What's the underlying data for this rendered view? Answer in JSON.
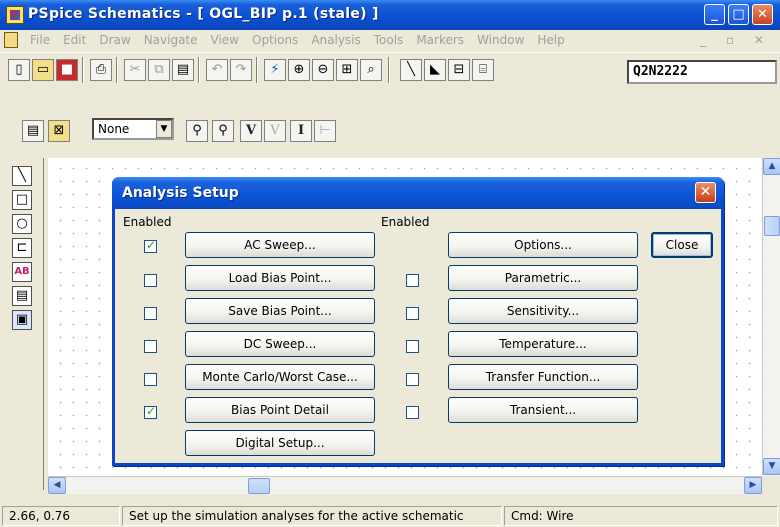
{
  "window": {
    "title": "PSpice Schematics - [ OGL_BIP  p.1  (stale) ]",
    "min_glyph": "_",
    "max_glyph": "□",
    "close_glyph": "✕"
  },
  "menu": {
    "items": [
      "File",
      "Edit",
      "Draw",
      "Navigate",
      "View",
      "Options",
      "Analysis",
      "Tools",
      "Markers",
      "Window",
      "Help"
    ],
    "mdi_controls": "_ ▫ ✕"
  },
  "toolbar": {
    "part_name": "Q2N2222",
    "display_combo": "None",
    "combo_arrow": "▼"
  },
  "status": {
    "coords": "2.66, 0.76",
    "message": "Set up the simulation analyses for the active schematic",
    "command": "Cmd: Wire"
  },
  "dialog": {
    "title": "Analysis Setup",
    "close_glyph": "✕",
    "left_header": "Enabled",
    "right_header": "Enabled",
    "close_button": "Close",
    "left": [
      {
        "label": "AC Sweep...",
        "checked": true
      },
      {
        "label": "Load Bias Point...",
        "checked": false
      },
      {
        "label": "Save Bias Point...",
        "checked": false
      },
      {
        "label": "DC Sweep...",
        "checked": false
      },
      {
        "label": "Monte Carlo/Worst Case...",
        "checked": false
      },
      {
        "label": "Bias Point Detail",
        "checked": true
      },
      {
        "label": "Digital Setup..."
      }
    ],
    "right": [
      {
        "label": "Options..."
      },
      {
        "label": "Parametric...",
        "checked": false
      },
      {
        "label": "Sensitivity...",
        "checked": false
      },
      {
        "label": "Temperature...",
        "checked": false
      },
      {
        "label": "Transfer Function...",
        "checked": false
      },
      {
        "label": "Transient...",
        "checked": false
      }
    ]
  },
  "glyphs": {
    "up": "▲",
    "down": "▼",
    "left": "◀",
    "right": "▶"
  }
}
